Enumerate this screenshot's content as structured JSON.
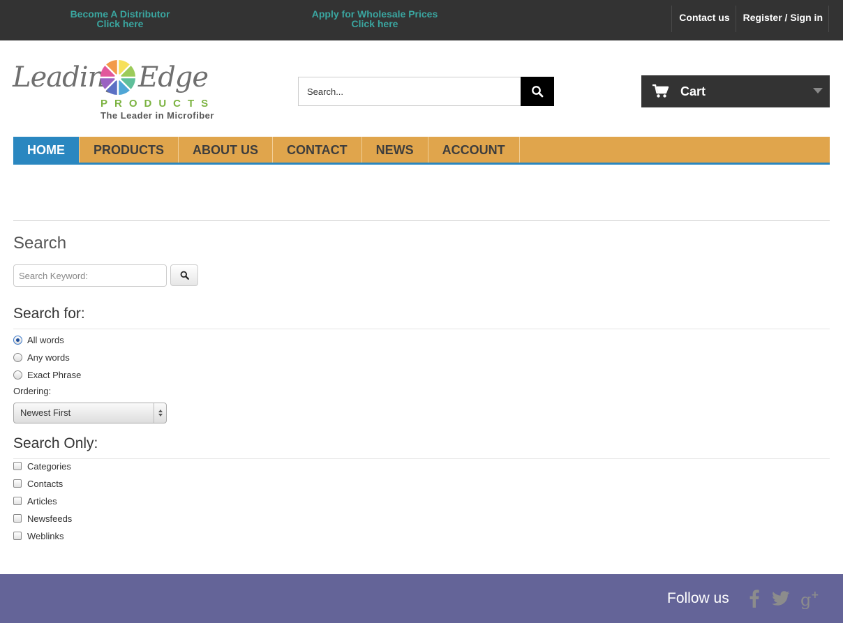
{
  "topbar": {
    "distributor_line1": "Become A Distributor",
    "distributor_line2": "Click here",
    "wholesale_line1": "Apply for Wholesale Prices",
    "wholesale_line2": "Click here",
    "contact_label": "Contact us",
    "register_label": "Register / Sign in"
  },
  "logo": {
    "word1": "Leading",
    "word2": "Edge",
    "products": "PRODUCTS",
    "tagline": "The Leader in Microfiber"
  },
  "header_search": {
    "placeholder": "Search...",
    "icon": "search-icon"
  },
  "cart": {
    "label": "Cart",
    "icon": "shopping-cart-icon"
  },
  "nav": {
    "items": [
      {
        "label": "HOME"
      },
      {
        "label": "PRODUCTS"
      },
      {
        "label": "ABOUT US"
      },
      {
        "label": "CONTACT"
      },
      {
        "label": "NEWS"
      },
      {
        "label": "ACCOUNT"
      }
    ],
    "active_index": 0
  },
  "search_page": {
    "title": "Search",
    "keyword_placeholder": "Search Keyword:",
    "search_for_heading": "Search for:",
    "search_for_options": [
      "All words",
      "Any words",
      "Exact Phrase"
    ],
    "selected_option": "All words",
    "ordering_label": "Ordering:",
    "ordering_value": "Newest First",
    "search_only_heading": "Search Only:",
    "search_only_options": [
      "Categories",
      "Contacts",
      "Articles",
      "Newsfeeds",
      "Weblinks"
    ]
  },
  "footer": {
    "follow_label": "Follow us",
    "social_icons": [
      "facebook-icon",
      "twitter-icon",
      "google-plus-icon"
    ]
  },
  "colors": {
    "topbar_bg": "#333333",
    "promo_text": "#3aa6a0",
    "nav_bg": "#e0a54c",
    "nav_active": "#2a87c0",
    "footer_bg": "#646498"
  }
}
